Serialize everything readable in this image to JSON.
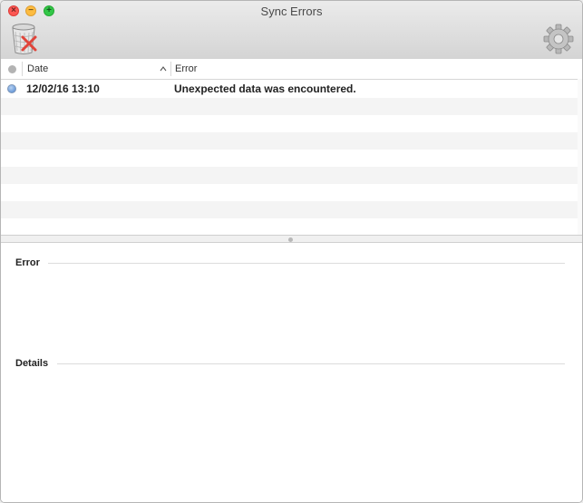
{
  "window": {
    "title": "Sync Errors"
  },
  "toolbar": {
    "clear_icon": "trash-clear-icon",
    "settings_icon": "gear-icon"
  },
  "table": {
    "columns": [
      {
        "key": "status",
        "label": ""
      },
      {
        "key": "date",
        "label": "Date",
        "sorted": "ascending"
      },
      {
        "key": "error",
        "label": "Error"
      }
    ],
    "rows": [
      {
        "date": "12/02/16 13:10",
        "error": "Unexpected data was encountered.",
        "status_color": "#4c84cf"
      }
    ]
  },
  "details": {
    "error_label": "Error",
    "details_label": "Details"
  },
  "colors": {
    "close": "#fc5753",
    "minimize": "#fdbc40",
    "maximize": "#33c748"
  }
}
